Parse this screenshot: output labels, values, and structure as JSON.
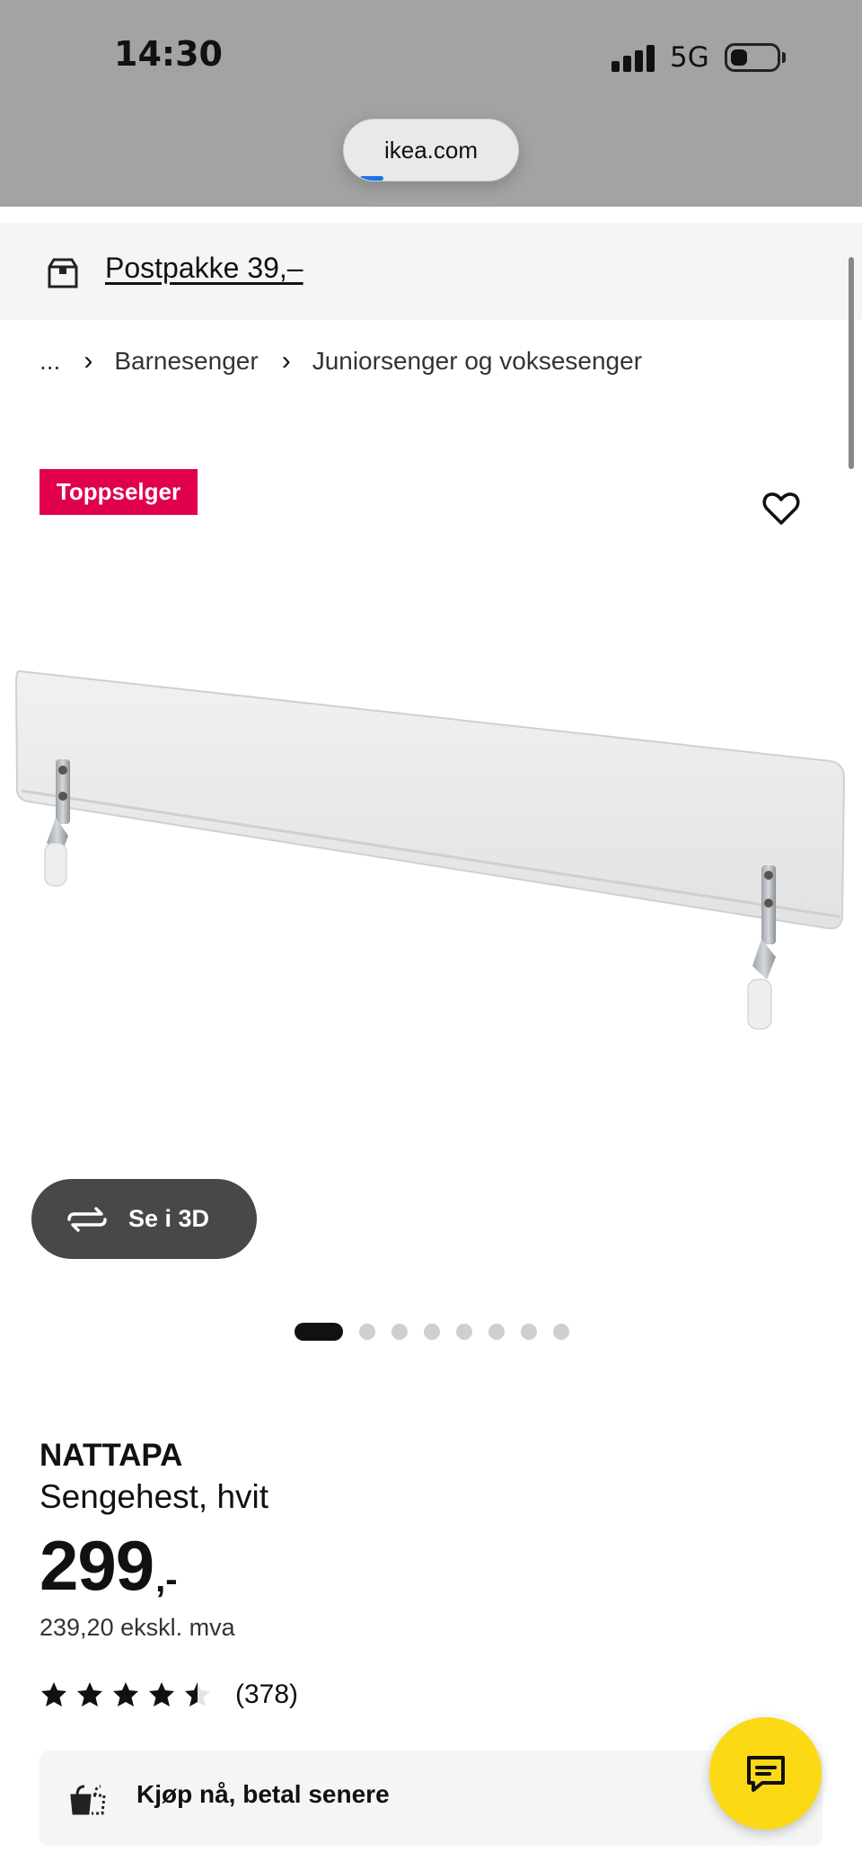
{
  "status_bar": {
    "time": "14:30",
    "network": "5G",
    "signal_icon": "signal-bars-icon",
    "battery_icon": "battery-icon"
  },
  "browser": {
    "url": "ikea.com"
  },
  "delivery": {
    "icon": "package-box-icon",
    "text": "Postpakke 39,–"
  },
  "breadcrumb": {
    "ellipsis": "...",
    "separator": "›",
    "items": [
      "Barnesenger",
      "Juniorsenger og voksesenger"
    ]
  },
  "gallery": {
    "badge": "Toppselger",
    "favorite_icon": "heart-outline-icon",
    "view_3d_label": "Se i 3D",
    "view_3d_icon": "rotate-arrows-icon",
    "image_count": 8,
    "active_image": 1
  },
  "product": {
    "name": "NATTAPA",
    "description": "Sengehest, hvit",
    "price": "299",
    "price_suffix": ",-",
    "price_ex_vat": "239,20 ekskl. mva",
    "rating": 4.5,
    "rating_max": 5,
    "review_count": "(378)"
  },
  "payment": {
    "icon": "buy-now-pay-later-icon",
    "label": "Kjøp nå, betal senere"
  },
  "chat": {
    "icon": "chat-bubble-icon"
  },
  "colors": {
    "badge_bg": "#e0004d",
    "chat_button": "#fbd914",
    "status_bar_bg": "#a3a3a3",
    "banner_bg": "#f5f5f5"
  }
}
